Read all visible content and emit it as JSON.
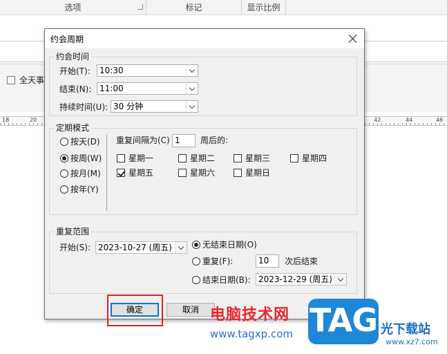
{
  "background": {
    "ribbon_groups": [
      "选项",
      "标记",
      "显示比例"
    ],
    "all_day_label": "全天事",
    "ruler_numbers": [
      "18",
      "20",
      "42",
      "44",
      "46"
    ]
  },
  "dialog": {
    "title": "约会周期",
    "time_group": {
      "label": "约会时间",
      "start_label": "开始(T):",
      "start_value": "10:30",
      "end_label": "结束(N):",
      "end_value": "11:00",
      "duration_label": "持续时间(U):",
      "duration_value": "30 分钟"
    },
    "pattern_group": {
      "label": "定期模式",
      "options": [
        "按天(D)",
        "按周(W)",
        "按月(M)",
        "按年(Y)"
      ],
      "selected_option": "按周(W)",
      "recur_prefix": "重复间隔为(C)",
      "recur_value": "1",
      "recur_suffix": "周后的:",
      "days": [
        {
          "label": "星期一",
          "checked": false
        },
        {
          "label": "星期二",
          "checked": false
        },
        {
          "label": "星期三",
          "checked": false
        },
        {
          "label": "星期四",
          "checked": false
        },
        {
          "label": "星期五",
          "checked": true
        },
        {
          "label": "星期六",
          "checked": false
        },
        {
          "label": "星期日",
          "checked": false
        }
      ]
    },
    "range_group": {
      "label": "重复范围",
      "start_label": "开始(S):",
      "start_value": "2023-10-27 (周五)",
      "no_end_label": "无结束日期(O)",
      "end_after_label": "重复(F):",
      "end_after_value": "10",
      "end_after_suffix": "次后结束",
      "end_by_label": "结束日期(B):",
      "end_by_value": "2023-12-29 (周五)",
      "selected": "no_end"
    },
    "buttons": {
      "ok": "确定",
      "cancel": "取消"
    }
  },
  "watermark": {
    "site_name": "电脑技术网",
    "site_url": "www.tagxp.com",
    "logo_text": "TAG",
    "side_name": "光下载站",
    "side_url": "www.xz7.com"
  },
  "colors": {
    "highlight": "#e02020",
    "watermark_red": "#e8262b",
    "watermark_blue": "#1e87d6"
  }
}
